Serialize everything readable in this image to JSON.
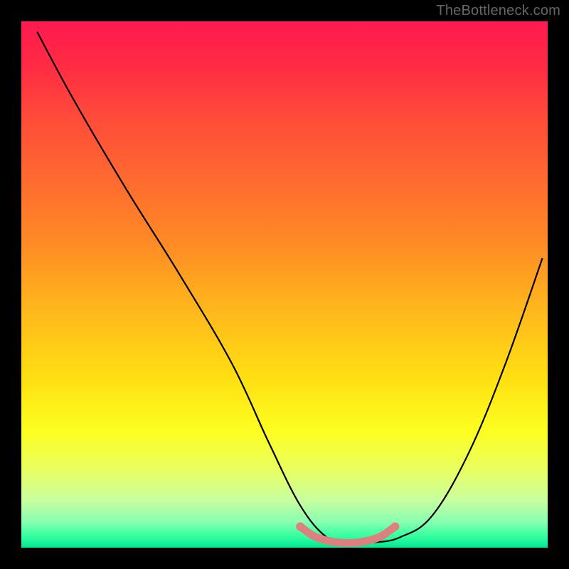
{
  "watermark": "TheBottleneck.com",
  "chart_data": {
    "type": "line",
    "title": "",
    "xlabel": "",
    "ylabel": "",
    "xlim": [
      0,
      100
    ],
    "ylim": [
      0,
      100
    ],
    "background_gradient": {
      "top_color": "#ff1a4f",
      "bottom_color": "#00e890",
      "stops": [
        {
          "pos": 0.0,
          "color": "#ff1a4f"
        },
        {
          "pos": 0.5,
          "color": "#ffe012"
        },
        {
          "pos": 1.0,
          "color": "#00e890"
        }
      ]
    },
    "series": [
      {
        "name": "bottleneck-curve",
        "color": "#000000",
        "x": [
          3,
          10,
          20,
          30,
          40,
          47,
          53,
          58,
          62,
          67,
          72,
          78,
          85,
          92,
          99
        ],
        "y": [
          98,
          85,
          68,
          52,
          35,
          20,
          8,
          2,
          1,
          1,
          2,
          6,
          18,
          35,
          55
        ]
      },
      {
        "name": "highlight-band",
        "color": "#e08080",
        "x": [
          53,
          56,
          60,
          64,
          68,
          71
        ],
        "y": [
          4,
          2,
          1,
          1,
          2,
          4
        ]
      }
    ]
  }
}
